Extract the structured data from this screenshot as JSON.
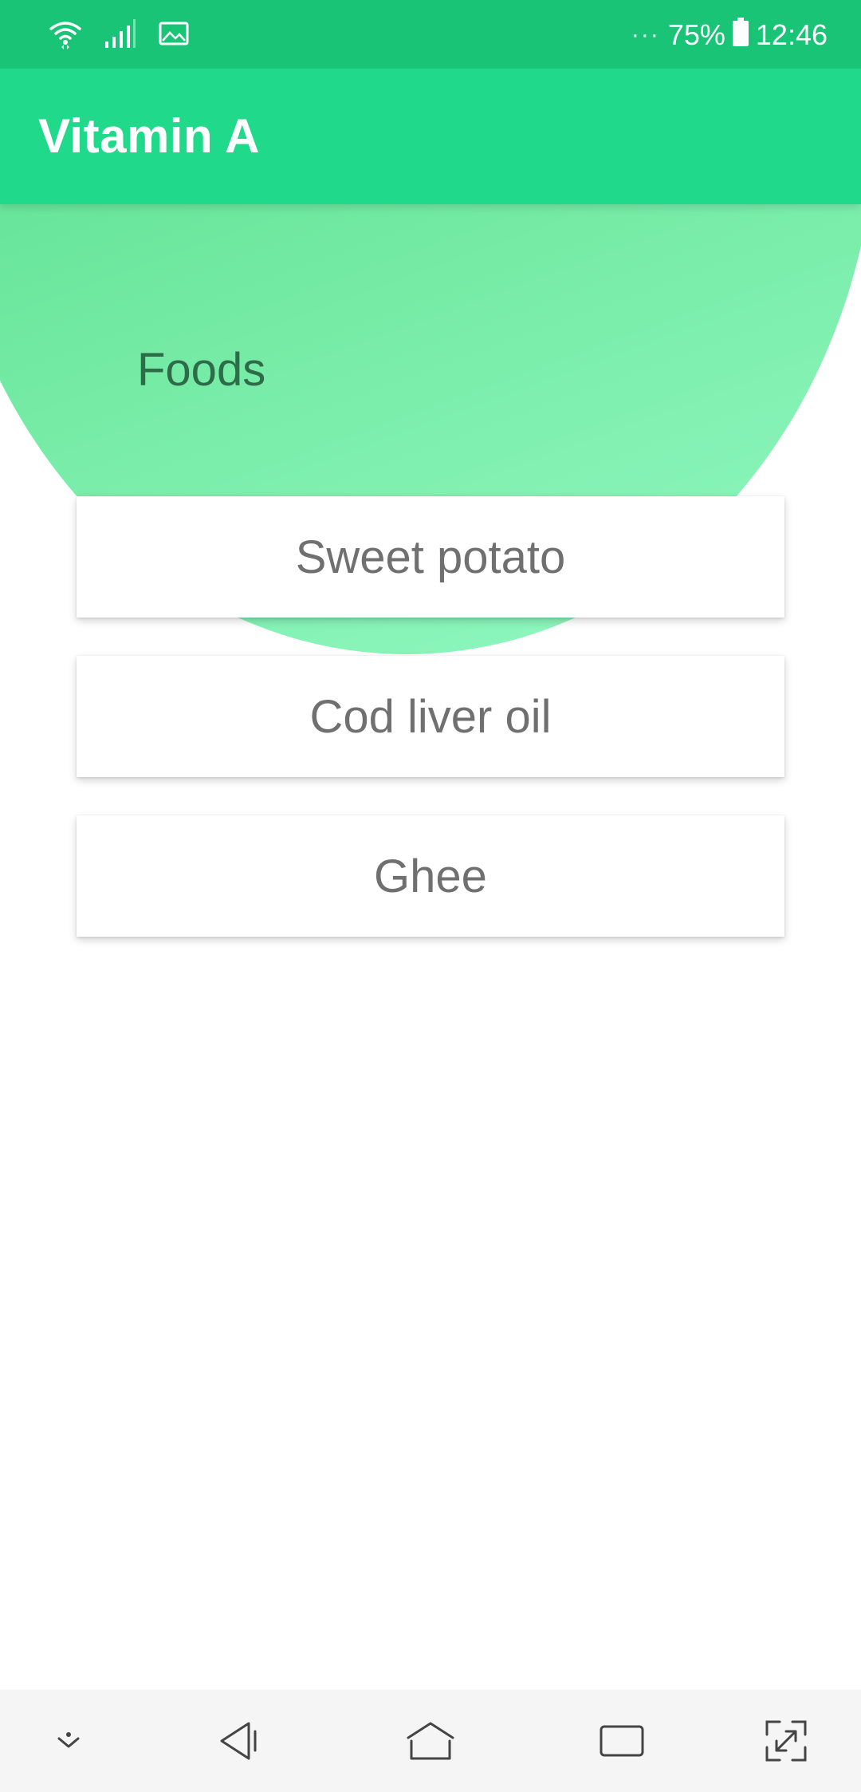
{
  "status_bar": {
    "overflow_dots": "···",
    "battery_percent": "75%",
    "time": "12:46",
    "icons": [
      "wifi-icon",
      "signal-icon",
      "image-notification-icon",
      "battery-icon"
    ]
  },
  "app_bar": {
    "title": "Vitamin A"
  },
  "content": {
    "section_title": "Foods",
    "foods": [
      {
        "label": "Sweet potato"
      },
      {
        "label": "Cod liver oil"
      },
      {
        "label": "Ghee"
      }
    ]
  },
  "nav_bar": {
    "icons": [
      "collapse-icon",
      "back-icon",
      "home-icon",
      "recents-icon",
      "expand-icon"
    ]
  },
  "colors": {
    "status_bar": "#19c476",
    "app_bar": "#21d98a",
    "circle_start": "#3fd680",
    "circle_end": "#93f9c2",
    "section_title": "#2e6b49",
    "card_text": "#707070"
  }
}
